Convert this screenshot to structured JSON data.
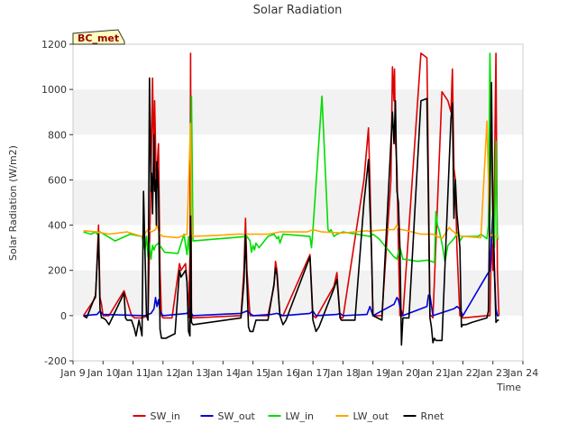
{
  "chart_data": {
    "type": "line",
    "title": "Solar Radiation",
    "xlabel": "Time",
    "ylabel": "Solar Radiation (W/m2)",
    "station_label": "BC_met",
    "xlim": [
      9,
      24
    ],
    "ylim": [
      -200,
      1200
    ],
    "x_ticks": [
      9,
      10,
      11,
      12,
      13,
      14,
      15,
      16,
      17,
      18,
      19,
      20,
      21,
      22,
      23,
      24
    ],
    "x_tick_labels": [
      "Jan 9",
      "Jan 10",
      "Jan 11",
      "Jan 12",
      "Jan 13",
      "Jan 14",
      "Jan 15",
      "Jan 16",
      "Jan 17",
      "Jan 18",
      "Jan 19",
      "Jan 20",
      "Jan 21",
      "Jan 22",
      "Jan 23",
      "Jan 24"
    ],
    "y_ticks": [
      -200,
      0,
      200,
      400,
      600,
      800,
      1000,
      1200
    ],
    "y_tick_labels": [
      "-200",
      "0",
      "200",
      "400",
      "600",
      "800",
      "1000",
      "1200"
    ],
    "grid": "horizontal bands",
    "legend_position": "bottom",
    "series": [
      {
        "name": "SW_in",
        "color": "#dd0000",
        "x": [
          9.35,
          9.75,
          9.85,
          9.9,
          9.95,
          10.0,
          10.2,
          10.7,
          10.95,
          11.05,
          11.3,
          11.5,
          11.6,
          11.65,
          11.7,
          11.72,
          11.75,
          11.78,
          11.8,
          11.85,
          11.9,
          11.95,
          12.0,
          12.3,
          12.55,
          12.6,
          12.75,
          12.8,
          12.85,
          12.9,
          12.92,
          12.95,
          13.0,
          14.6,
          14.7,
          14.75,
          14.8,
          14.9,
          15.0,
          15.5,
          15.7,
          15.75,
          15.8,
          15.9,
          16.0,
          16.9,
          17.0,
          17.1,
          17.7,
          17.8,
          17.85,
          17.9,
          17.95,
          18.0,
          18.7,
          18.85,
          18.9,
          18.95,
          19.0,
          19.3,
          19.6,
          19.65,
          19.7,
          19.72,
          19.75,
          19.8,
          19.85,
          19.9,
          19.95,
          20.0,
          20.6,
          20.8,
          20.82,
          20.85,
          20.9,
          20.95,
          21.0,
          21.3,
          21.5,
          21.6,
          21.65,
          21.7,
          21.75,
          21.8,
          21.9,
          21.95,
          22.0,
          22.8,
          22.9,
          22.95,
          23.0,
          23.05,
          23.1,
          23.15,
          23.2
        ],
        "y": [
          0,
          80,
          400,
          80,
          50,
          0,
          0,
          110,
          0,
          -10,
          -10,
          0,
          620,
          1050,
          620,
          950,
          760,
          400,
          650,
          760,
          200,
          0,
          -10,
          -10,
          230,
          200,
          230,
          150,
          -10,
          260,
          1160,
          0,
          -10,
          0,
          200,
          430,
          200,
          0,
          0,
          0,
          130,
          240,
          200,
          0,
          0,
          270,
          0,
          -10,
          130,
          190,
          90,
          0,
          -10,
          -10,
          600,
          830,
          600,
          300,
          0,
          0,
          600,
          1100,
          950,
          1090,
          780,
          650,
          300,
          0,
          0,
          0,
          1160,
          1140,
          950,
          600,
          0,
          0,
          -10,
          990,
          950,
          900,
          1090,
          650,
          600,
          300,
          0,
          0,
          -10,
          0,
          0,
          350,
          200,
          600,
          1160,
          200,
          0
        ]
      },
      {
        "name": "SW_out",
        "color": "#0000dd",
        "x": [
          9.35,
          9.8,
          9.9,
          10.0,
          11.4,
          11.5,
          11.6,
          11.7,
          11.75,
          11.8,
          11.85,
          11.9,
          11.95,
          12.0,
          12.8,
          12.9,
          12.95,
          13.0,
          14.6,
          14.8,
          15.0,
          15.6,
          15.8,
          16.0,
          16.9,
          17.0,
          17.1,
          17.8,
          17.9,
          18.0,
          18.8,
          18.9,
          19.0,
          19.7,
          19.8,
          19.85,
          19.9,
          20.0,
          20.8,
          20.85,
          20.9,
          21.0,
          21.7,
          21.8,
          21.9,
          22.0,
          22.8,
          22.9,
          23.0,
          23.05,
          23.1,
          23.15,
          23.2
        ],
        "y": [
          0,
          5,
          20,
          5,
          0,
          5,
          10,
          30,
          80,
          40,
          70,
          20,
          10,
          0,
          10,
          30,
          10,
          0,
          10,
          20,
          0,
          5,
          10,
          0,
          10,
          20,
          0,
          5,
          10,
          0,
          5,
          40,
          0,
          50,
          80,
          70,
          40,
          0,
          40,
          90,
          90,
          0,
          30,
          40,
          30,
          0,
          180,
          200,
          480,
          200,
          30,
          0,
          0
        ]
      },
      {
        "name": "LW_in",
        "color": "#00dd00",
        "x": [
          9.35,
          9.6,
          9.75,
          9.8,
          9.9,
          10.4,
          10.9,
          11.3,
          11.4,
          11.45,
          11.5,
          11.55,
          11.6,
          11.65,
          11.7,
          11.75,
          11.85,
          11.95,
          12.05,
          12.5,
          12.7,
          12.8,
          12.85,
          12.9,
          12.92,
          12.95,
          13.0,
          14.8,
          14.9,
          14.95,
          15.0,
          15.05,
          15.1,
          15.2,
          15.5,
          15.7,
          15.8,
          15.85,
          15.9,
          16.0,
          16.9,
          16.95,
          17.0,
          17.3,
          17.5,
          17.55,
          17.6,
          17.7,
          17.8,
          18.0,
          18.9,
          19.0,
          19.2,
          19.7,
          19.8,
          19.85,
          19.9,
          20.0,
          20.5,
          20.8,
          20.95,
          21.05,
          21.1,
          21.15,
          21.2,
          21.3,
          21.4,
          21.5,
          21.7,
          21.85,
          21.9,
          22.0,
          22.5,
          22.6,
          22.7,
          22.8,
          22.85,
          22.9,
          22.95,
          23.0,
          23.05,
          23.1,
          23.15,
          23.2
        ],
        "y": [
          370,
          360,
          370,
          360,
          370,
          330,
          360,
          350,
          290,
          350,
          260,
          320,
          250,
          310,
          290,
          310,
          320,
          300,
          280,
          275,
          360,
          270,
          350,
          260,
          350,
          970,
          330,
          350,
          330,
          280,
          310,
          290,
          320,
          300,
          350,
          360,
          340,
          350,
          320,
          360,
          350,
          300,
          380,
          970,
          380,
          370,
          380,
          350,
          360,
          370,
          350,
          360,
          340,
          260,
          250,
          280,
          300,
          250,
          240,
          245,
          240,
          235,
          460,
          400,
          380,
          320,
          240,
          310,
          340,
          370,
          330,
          350,
          350,
          360,
          350,
          340,
          400,
          1160,
          800,
          340,
          300,
          770,
          340,
          340
        ]
      },
      {
        "name": "LW_out",
        "color": "#ffa500",
        "x": [
          9.35,
          9.8,
          10.2,
          10.8,
          11.3,
          11.5,
          11.6,
          11.75,
          11.8,
          11.9,
          12.0,
          12.5,
          12.8,
          12.92,
          12.95,
          12.98,
          13.0,
          13.8,
          14.5,
          14.8,
          15.0,
          15.5,
          15.9,
          16.8,
          17.0,
          17.3,
          18.0,
          18.4,
          18.8,
          18.95,
          19.0,
          19.5,
          19.7,
          19.8,
          19.9,
          20.0,
          20.6,
          21.0,
          21.3,
          21.5,
          21.55,
          21.6,
          21.7,
          21.8,
          22.0,
          22.6,
          22.8,
          22.9,
          23.0,
          23.05,
          23.1,
          23.2
        ],
        "y": [
          375,
          370,
          360,
          370,
          350,
          380,
          370,
          380,
          400,
          360,
          350,
          345,
          360,
          850,
          500,
          360,
          350,
          355,
          360,
          360,
          360,
          360,
          370,
          370,
          380,
          370,
          365,
          370,
          375,
          370,
          375,
          380,
          380,
          400,
          380,
          380,
          360,
          360,
          340,
          380,
          390,
          380,
          370,
          355,
          350,
          345,
          860,
          350,
          360,
          355,
          350,
          350
        ]
      },
      {
        "name": "Rnet",
        "color": "#000000",
        "x": [
          9.35,
          9.45,
          9.75,
          9.85,
          9.9,
          9.95,
          10.0,
          10.1,
          10.2,
          10.7,
          10.75,
          10.8,
          10.95,
          11.05,
          11.1,
          11.2,
          11.3,
          11.35,
          11.45,
          11.5,
          11.55,
          11.6,
          11.62,
          11.65,
          11.7,
          11.72,
          11.75,
          11.78,
          11.8,
          11.85,
          11.9,
          11.95,
          12.0,
          12.1,
          12.4,
          12.55,
          12.6,
          12.75,
          12.8,
          12.85,
          12.9,
          12.92,
          12.95,
          13.0,
          14.6,
          14.7,
          14.75,
          14.8,
          14.85,
          14.9,
          15.0,
          15.1,
          15.5,
          15.7,
          15.75,
          15.8,
          15.9,
          16.0,
          16.1,
          16.9,
          17.0,
          17.1,
          17.2,
          17.7,
          17.8,
          17.85,
          17.9,
          17.95,
          18.0,
          18.1,
          18.4,
          18.7,
          18.85,
          18.9,
          18.95,
          19.0,
          19.3,
          19.65,
          19.7,
          19.75,
          19.8,
          19.85,
          19.9,
          19.95,
          20.0,
          20.05,
          20.2,
          20.6,
          20.8,
          20.85,
          20.9,
          20.95,
          21.0,
          21.05,
          21.1,
          21.3,
          21.6,
          21.65,
          21.7,
          21.75,
          21.8,
          21.9,
          21.95,
          22.0,
          22.1,
          22.3,
          22.8,
          22.85,
          22.9,
          22.95,
          23.0,
          23.05,
          23.1,
          23.15,
          23.2
        ],
        "y": [
          0,
          -10,
          90,
          360,
          30,
          -10,
          -10,
          -20,
          -40,
          100,
          -10,
          -20,
          -20,
          -60,
          -90,
          -20,
          -90,
          550,
          0,
          -20,
          1050,
          550,
          630,
          450,
          800,
          550,
          600,
          400,
          680,
          550,
          -60,
          -100,
          -100,
          -100,
          -80,
          200,
          170,
          200,
          150,
          -70,
          -90,
          440,
          -30,
          -40,
          -10,
          150,
          360,
          150,
          -50,
          -70,
          -70,
          -20,
          -20,
          140,
          210,
          180,
          0,
          -40,
          -20,
          260,
          -20,
          -70,
          -50,
          120,
          160,
          80,
          -10,
          -20,
          -20,
          -20,
          -20,
          500,
          690,
          480,
          300,
          0,
          -20,
          900,
          760,
          950,
          550,
          500,
          300,
          -130,
          -10,
          -10,
          -10,
          950,
          960,
          500,
          -10,
          -50,
          -120,
          -100,
          -110,
          -110,
          870,
          940,
          430,
          600,
          450,
          300,
          -50,
          -40,
          -40,
          -30,
          -10,
          20,
          540,
          1030,
          460,
          200,
          -30,
          -20,
          -20
        ]
      }
    ]
  }
}
